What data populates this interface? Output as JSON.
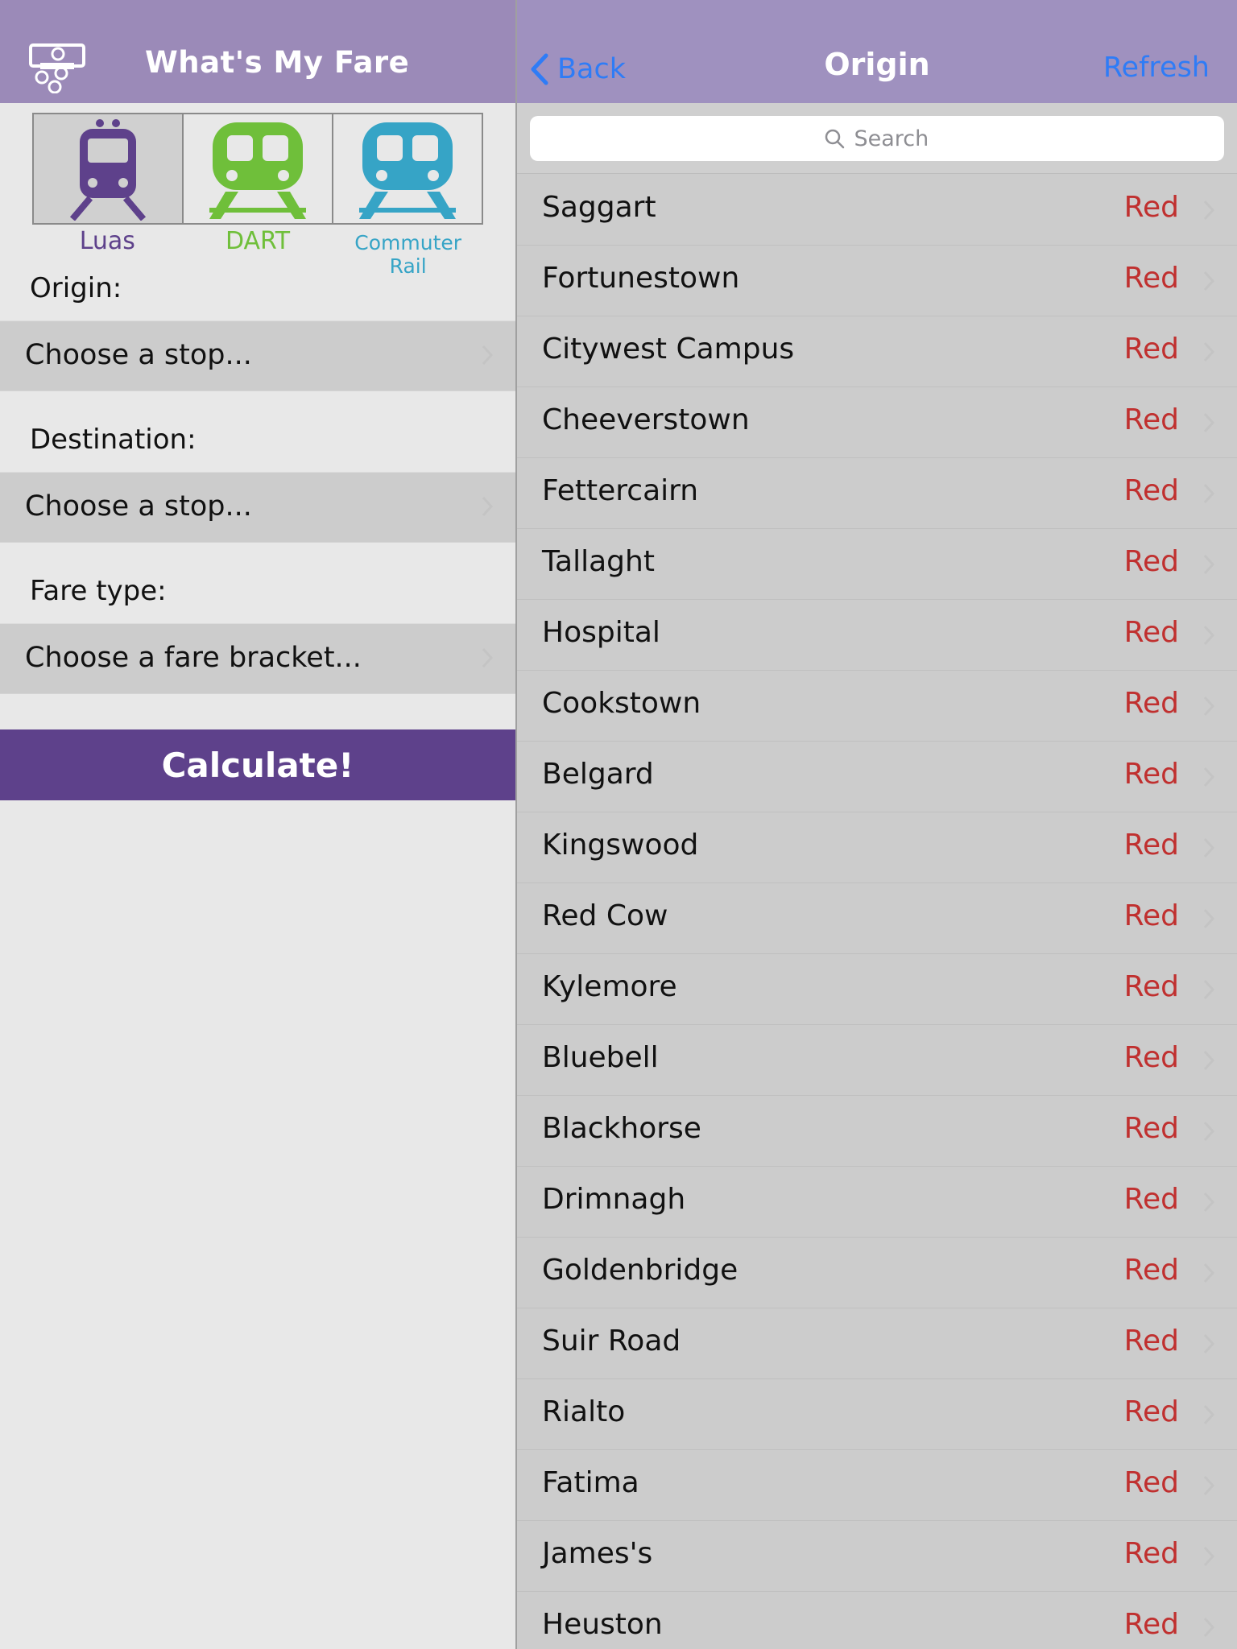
{
  "app": {
    "title": "What's My Fare"
  },
  "modes": [
    {
      "label": "Luas",
      "color": "#5e418b",
      "selected": true
    },
    {
      "label": "DART",
      "color": "#6fbf3a",
      "selected": false
    },
    {
      "label": "Commuter Rail",
      "color": "#36a4c6",
      "selected": false
    }
  ],
  "form": {
    "origin_label": "Origin:",
    "origin_value": "Choose a stop...",
    "destination_label": "Destination:",
    "destination_value": "Choose a stop...",
    "fare_label": "Fare type:",
    "fare_value": "Choose a fare bracket...",
    "calculate_label": "Calculate!"
  },
  "picker": {
    "back_label": "Back",
    "title": "Origin",
    "refresh_label": "Refresh",
    "search_placeholder": "Search",
    "line_color": "#c0302f",
    "stops": [
      {
        "name": "Saggart",
        "line": "Red"
      },
      {
        "name": "Fortunestown",
        "line": "Red"
      },
      {
        "name": "Citywest Campus",
        "line": "Red"
      },
      {
        "name": "Cheeverstown",
        "line": "Red"
      },
      {
        "name": "Fettercairn",
        "line": "Red"
      },
      {
        "name": "Tallaght",
        "line": "Red"
      },
      {
        "name": "Hospital",
        "line": "Red"
      },
      {
        "name": "Cookstown",
        "line": "Red"
      },
      {
        "name": "Belgard",
        "line": "Red"
      },
      {
        "name": "Kingswood",
        "line": "Red"
      },
      {
        "name": "Red Cow",
        "line": "Red"
      },
      {
        "name": "Kylemore",
        "line": "Red"
      },
      {
        "name": "Bluebell",
        "line": "Red"
      },
      {
        "name": "Blackhorse",
        "line": "Red"
      },
      {
        "name": "Drimnagh",
        "line": "Red"
      },
      {
        "name": "Goldenbridge",
        "line": "Red"
      },
      {
        "name": "Suir Road",
        "line": "Red"
      },
      {
        "name": "Rialto",
        "line": "Red"
      },
      {
        "name": "Fatima",
        "line": "Red"
      },
      {
        "name": "James's",
        "line": "Red"
      },
      {
        "name": "Heuston",
        "line": "Red"
      }
    ]
  }
}
